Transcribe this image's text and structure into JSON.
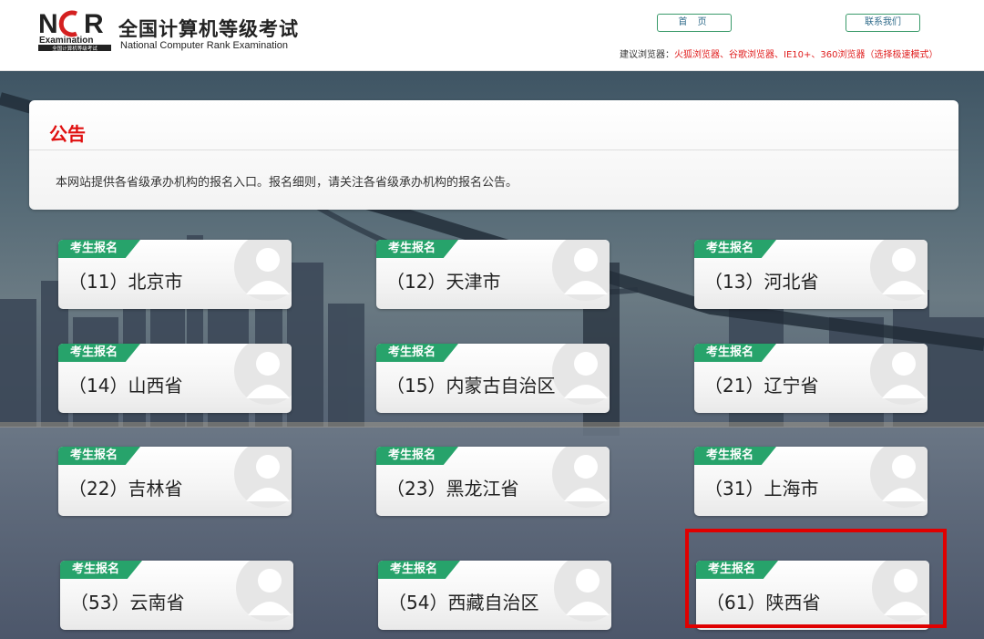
{
  "header": {
    "logo_mark_text": "NCR",
    "logo_mark_sub": "Examination",
    "logo_mark_tiny": "全国计算机等级考试",
    "title": "全国计算机等级考试",
    "subtitle": "National Computer Rank Examination",
    "home_label": "首 页",
    "contact_label": "联系我们",
    "browser_tip_label": "建议浏览器：",
    "browser_tip_list": "火狐浏览器、谷歌浏览器、IE10+、360浏览器（选择极速模式）"
  },
  "notice": {
    "title": "公告",
    "text": "本网站提供各省级承办机构的报名入口。报名细则，请关注各省级承办机构的报名公告。"
  },
  "card_tag_label": "考生报名",
  "provinces": [
    {
      "label": "（11）北京市"
    },
    {
      "label": "（12）天津市"
    },
    {
      "label": "（13）河北省"
    },
    {
      "label": "（14）山西省"
    },
    {
      "label": "（15）内蒙古自治区"
    },
    {
      "label": "（21）辽宁省"
    },
    {
      "label": "（22）吉林省"
    },
    {
      "label": "（23）黑龙江省"
    },
    {
      "label": "（31）上海市"
    },
    {
      "label": "（53）云南省"
    },
    {
      "label": "（54）西藏自治区"
    },
    {
      "label": "（61）陕西省",
      "highlighted": true
    }
  ],
  "colors": {
    "accent_red": "#e01010",
    "tag_green": "#27a36b",
    "highlight": "#e00000"
  }
}
